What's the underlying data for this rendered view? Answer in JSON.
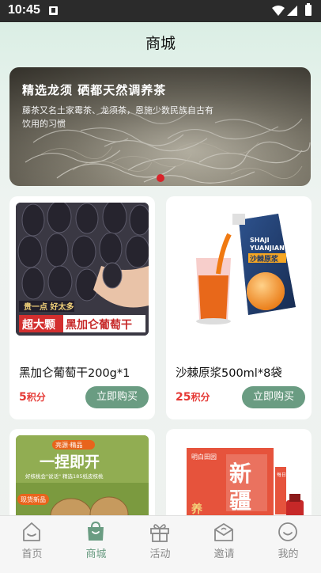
{
  "status": {
    "time": "10:45"
  },
  "page": {
    "title": "商城"
  },
  "banner": {
    "headline": "精选龙须  硒都天然调养茶",
    "description": "藤茶又名土家霉茶、龙须茶，恩施少数民族自古有饮用的习惯"
  },
  "products": [
    {
      "name": "黑加仑葡萄干200g*1",
      "points_value": "5",
      "points_unit": "积分",
      "buy_label": "立即购买",
      "image_text": {
        "top": "贵一点 好太多",
        "left": "超大颗",
        "right": "黑加仑葡萄干"
      }
    },
    {
      "name": "沙棘原浆500ml*8袋",
      "points_value": "25",
      "points_unit": "积分",
      "buy_label": "立即购买",
      "image_text": {
        "brand_line1": "SHAJI",
        "brand_line2": "YUANJIANG",
        "cn": "沙棘原浆"
      }
    },
    {
      "name": "",
      "image_text": {
        "tag": "亮源·精品",
        "big": "一捏即开",
        "sub": "好核桃会\"说话\" 精选185纸皮核桃",
        "badge": "现货新品"
      }
    },
    {
      "name": "",
      "image_text": {
        "top": "明白田园",
        "big1": "新",
        "big2": "疆",
        "side": "每日红枣膳",
        "mini": "养"
      }
    }
  ],
  "tabs": [
    {
      "label": "首页",
      "icon": "home-icon",
      "active": false
    },
    {
      "label": "商城",
      "icon": "shopping-bag-icon",
      "active": true
    },
    {
      "label": "活动",
      "icon": "gift-icon",
      "active": false
    },
    {
      "label": "邀请",
      "icon": "invite-envelope-icon",
      "active": false
    },
    {
      "label": "我的",
      "icon": "profile-icon",
      "active": false
    }
  ],
  "colors": {
    "accent": "#6a9c82",
    "price": "#e53935",
    "status_bar": "#2b2b2b"
  }
}
